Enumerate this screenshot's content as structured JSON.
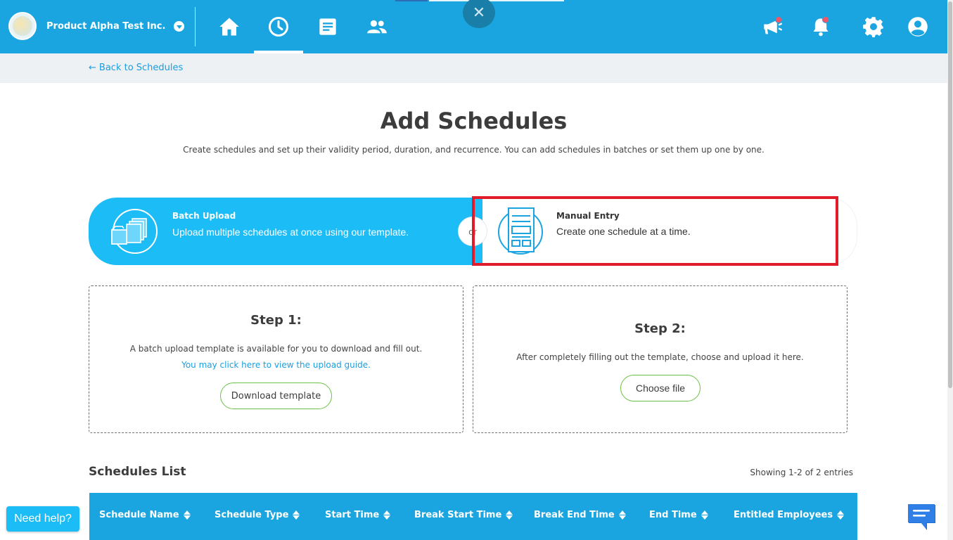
{
  "header": {
    "company_name": "Product Alpha Test Inc.",
    "nav": [
      {
        "icon": "home-icon"
      },
      {
        "icon": "clock-icon",
        "active": true
      },
      {
        "icon": "document-icon"
      },
      {
        "icon": "people-icon"
      }
    ],
    "close_symbol": "✕",
    "right_icons": [
      "megaphone-icon",
      "bell-icon",
      "gear-icon",
      "user-icon"
    ],
    "accent": "#1aa5e0"
  },
  "subbar": {
    "back_label": "Back to Schedules",
    "back_arrow": "←"
  },
  "main": {
    "title": "Add Schedules",
    "description": "Create schedules and set up their validity period, duration, and recurrence. You can add schedules in batches or set them up one by one.",
    "modes": {
      "batch": {
        "title": "Batch Upload",
        "desc": "Upload multiple schedules at once using our template."
      },
      "or_label": "or",
      "manual": {
        "title": "Manual Entry",
        "desc": "Create one schedule at a time."
      }
    },
    "step1": {
      "title": "Step 1:",
      "text": "A batch upload template is available for you to download and fill out.",
      "link": "You may click here to view the upload guide.",
      "button": "Download template"
    },
    "step2": {
      "title": "Step 2:",
      "text": "After completely filling out the template, choose and upload it here.",
      "button": "Choose file"
    }
  },
  "schedules_list": {
    "title": "Schedules List",
    "entries": "Showing 1-2 of 2 entries",
    "columns": [
      "Schedule Name",
      "Schedule Type",
      "Start Time",
      "Break Start Time",
      "Break End Time",
      "End Time",
      "Entitled Employees"
    ]
  },
  "help": {
    "need_help": "Need help?"
  }
}
